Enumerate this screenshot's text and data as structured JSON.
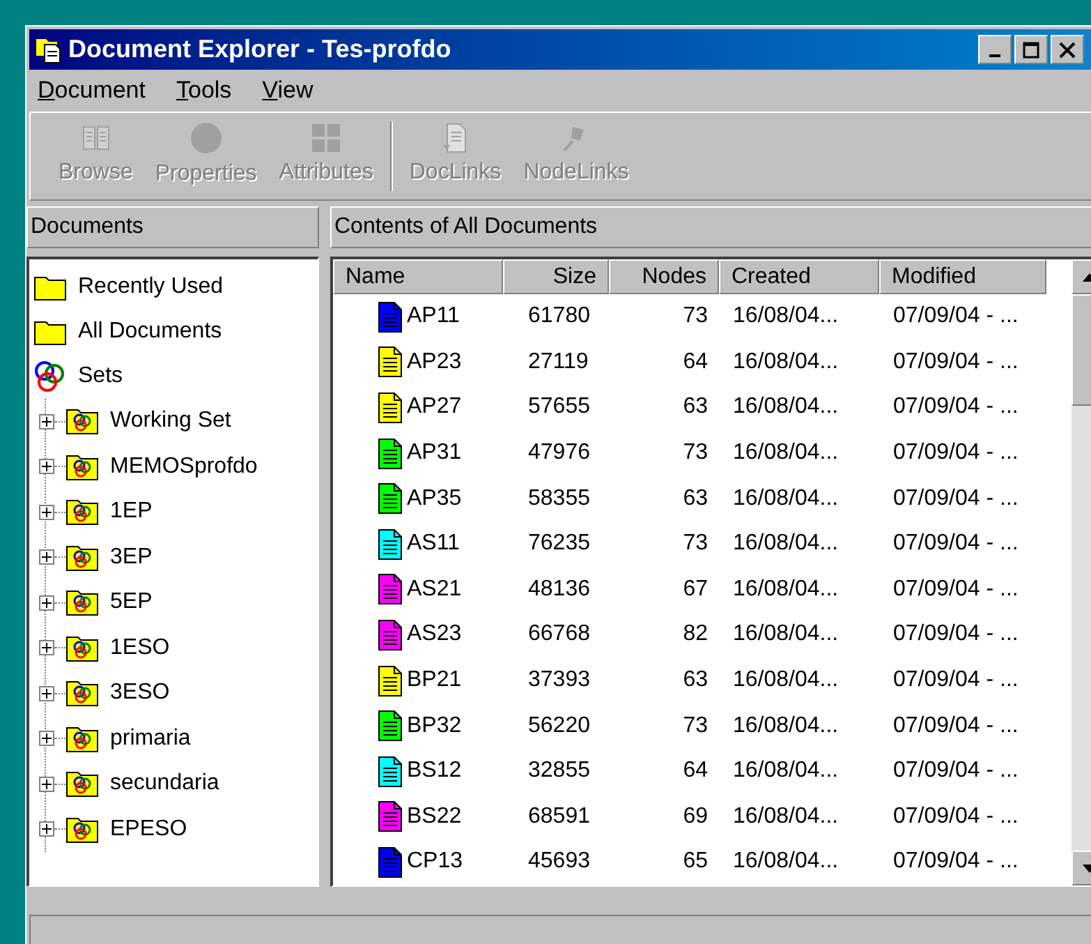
{
  "window": {
    "title": "Document Explorer - Tes-profdo"
  },
  "menu": [
    {
      "label": "Document"
    },
    {
      "label": "Tools"
    },
    {
      "label": "View"
    }
  ],
  "toolbar": [
    {
      "label": "Browse",
      "kind": "browse",
      "disabled": true
    },
    {
      "label": "Properties",
      "kind": "properties",
      "disabled": true
    },
    {
      "label": "Attributes",
      "kind": "attributes",
      "disabled": true
    },
    {
      "kind": "separator"
    },
    {
      "label": "DocLinks",
      "kind": "doclinks",
      "disabled": true
    },
    {
      "label": "NodeLinks",
      "kind": "nodelinks",
      "disabled": true
    }
  ],
  "left_panel": {
    "title": "Documents",
    "tree": [
      {
        "label": "Recently Used",
        "kind": "folder"
      },
      {
        "label": "All Documents",
        "kind": "folder"
      },
      {
        "label": "Sets",
        "kind": "sets",
        "children": [
          {
            "label": "Working Set",
            "kind": "set",
            "expanded": false
          },
          {
            "label": "MEMOSprofdo",
            "kind": "set",
            "expanded": false
          },
          {
            "label": "1EP",
            "kind": "set",
            "expanded": false
          },
          {
            "label": "3EP",
            "kind": "set",
            "expanded": false
          },
          {
            "label": "5EP",
            "kind": "set",
            "expanded": false
          },
          {
            "label": "1ESO",
            "kind": "set",
            "expanded": false
          },
          {
            "label": "3ESO",
            "kind": "set",
            "expanded": false
          },
          {
            "label": "primaria",
            "kind": "set",
            "expanded": false
          },
          {
            "label": "secundaria",
            "kind": "set",
            "expanded": false
          },
          {
            "label": "EPESO",
            "kind": "set",
            "expanded": false
          }
        ]
      }
    ]
  },
  "right_panel": {
    "title": "Contents of All Documents",
    "table": {
      "columns": [
        "Name",
        "Size",
        "Nodes",
        "Created",
        "Modified"
      ],
      "rows": [
        {
          "name": "AP11",
          "size": "61780",
          "nodes": "73",
          "created": "16/08/04...",
          "modified": "07/09/04 - ...",
          "color": "#0000ff"
        },
        {
          "name": "AP23",
          "size": "27119",
          "nodes": "64",
          "created": "16/08/04...",
          "modified": "07/09/04 - ...",
          "color": "#ffff00"
        },
        {
          "name": "AP27",
          "size": "57655",
          "nodes": "63",
          "created": "16/08/04...",
          "modified": "07/09/04 - ...",
          "color": "#ffff00"
        },
        {
          "name": "AP31",
          "size": "47976",
          "nodes": "73",
          "created": "16/08/04...",
          "modified": "07/09/04 - ...",
          "color": "#00ff00"
        },
        {
          "name": "AP35",
          "size": "58355",
          "nodes": "63",
          "created": "16/08/04...",
          "modified": "07/09/04 - ...",
          "color": "#00ff00"
        },
        {
          "name": "AS11",
          "size": "76235",
          "nodes": "73",
          "created": "16/08/04...",
          "modified": "07/09/04 - ...",
          "color": "#00ffff"
        },
        {
          "name": "AS21",
          "size": "48136",
          "nodes": "67",
          "created": "16/08/04...",
          "modified": "07/09/04 - ...",
          "color": "#ff00ff"
        },
        {
          "name": "AS23",
          "size": "66768",
          "nodes": "82",
          "created": "16/08/04...",
          "modified": "07/09/04 - ...",
          "color": "#ff00ff"
        },
        {
          "name": "BP21",
          "size": "37393",
          "nodes": "63",
          "created": "16/08/04...",
          "modified": "07/09/04 - ...",
          "color": "#ffff00"
        },
        {
          "name": "BP32",
          "size": "56220",
          "nodes": "73",
          "created": "16/08/04...",
          "modified": "07/09/04 - ...",
          "color": "#00ff00"
        },
        {
          "name": "BS12",
          "size": "32855",
          "nodes": "64",
          "created": "16/08/04...",
          "modified": "07/09/04 - ...",
          "color": "#00ffff"
        },
        {
          "name": "BS22",
          "size": "68591",
          "nodes": "69",
          "created": "16/08/04...",
          "modified": "07/09/04 - ...",
          "color": "#ff00ff"
        },
        {
          "name": "CP13",
          "size": "45693",
          "nodes": "65",
          "created": "16/08/04...",
          "modified": "07/09/04 - ...",
          "color": "#0000ff"
        }
      ]
    }
  }
}
